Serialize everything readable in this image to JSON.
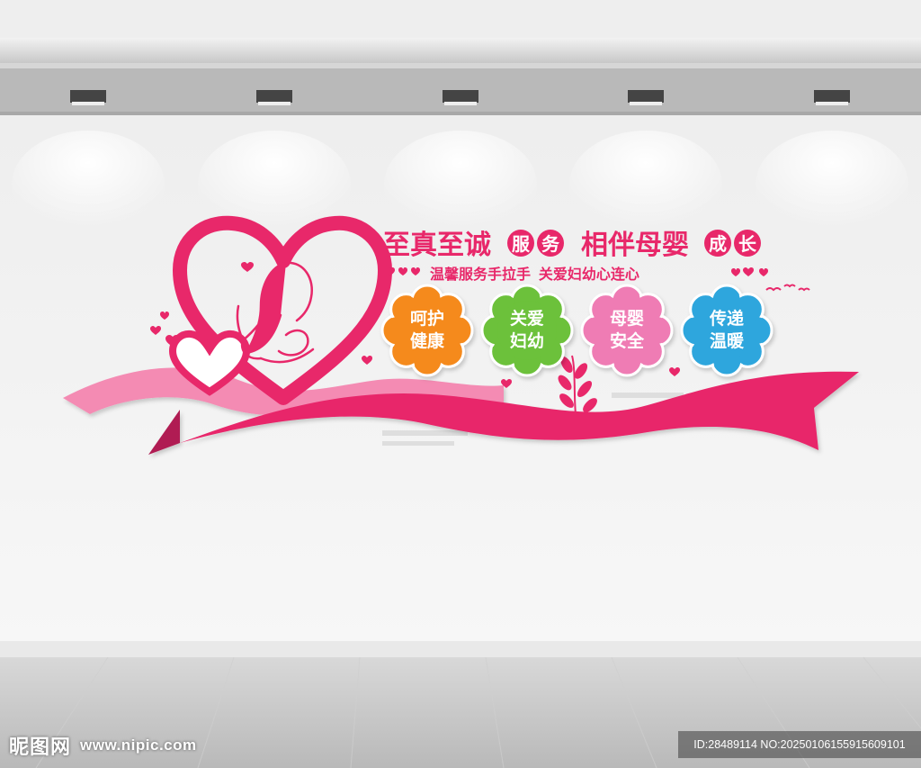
{
  "headline": {
    "part1": "至真至诚",
    "badge1_char1": "服",
    "badge1_char2": "务",
    "part2": "相伴母婴",
    "badge2_char1": "成",
    "badge2_char2": "长"
  },
  "subline": "温馨服务手拉手  关爱妇幼心连心",
  "flowers": [
    {
      "line1": "呵护",
      "line2": "健康",
      "color": "#f58a1f"
    },
    {
      "line1": "关爱",
      "line2": "妇幼",
      "color": "#6cc13a"
    },
    {
      "line1": "母婴",
      "line2": "安全",
      "color": "#ef7cb4"
    },
    {
      "line1": "传递",
      "line2": "温暖",
      "color": "#2ea6dd"
    }
  ],
  "colors": {
    "primary_pink": "#e8286a",
    "light_pink": "#f48bb3",
    "wall": "#f3f3f3",
    "ceiling": "#dcdcdc",
    "floor": "#c9c9c9"
  },
  "watermark": {
    "logo": "昵图网",
    "url": "www.nipic.com",
    "id_text": "ID:28489114 NO:20250106155915609101"
  }
}
